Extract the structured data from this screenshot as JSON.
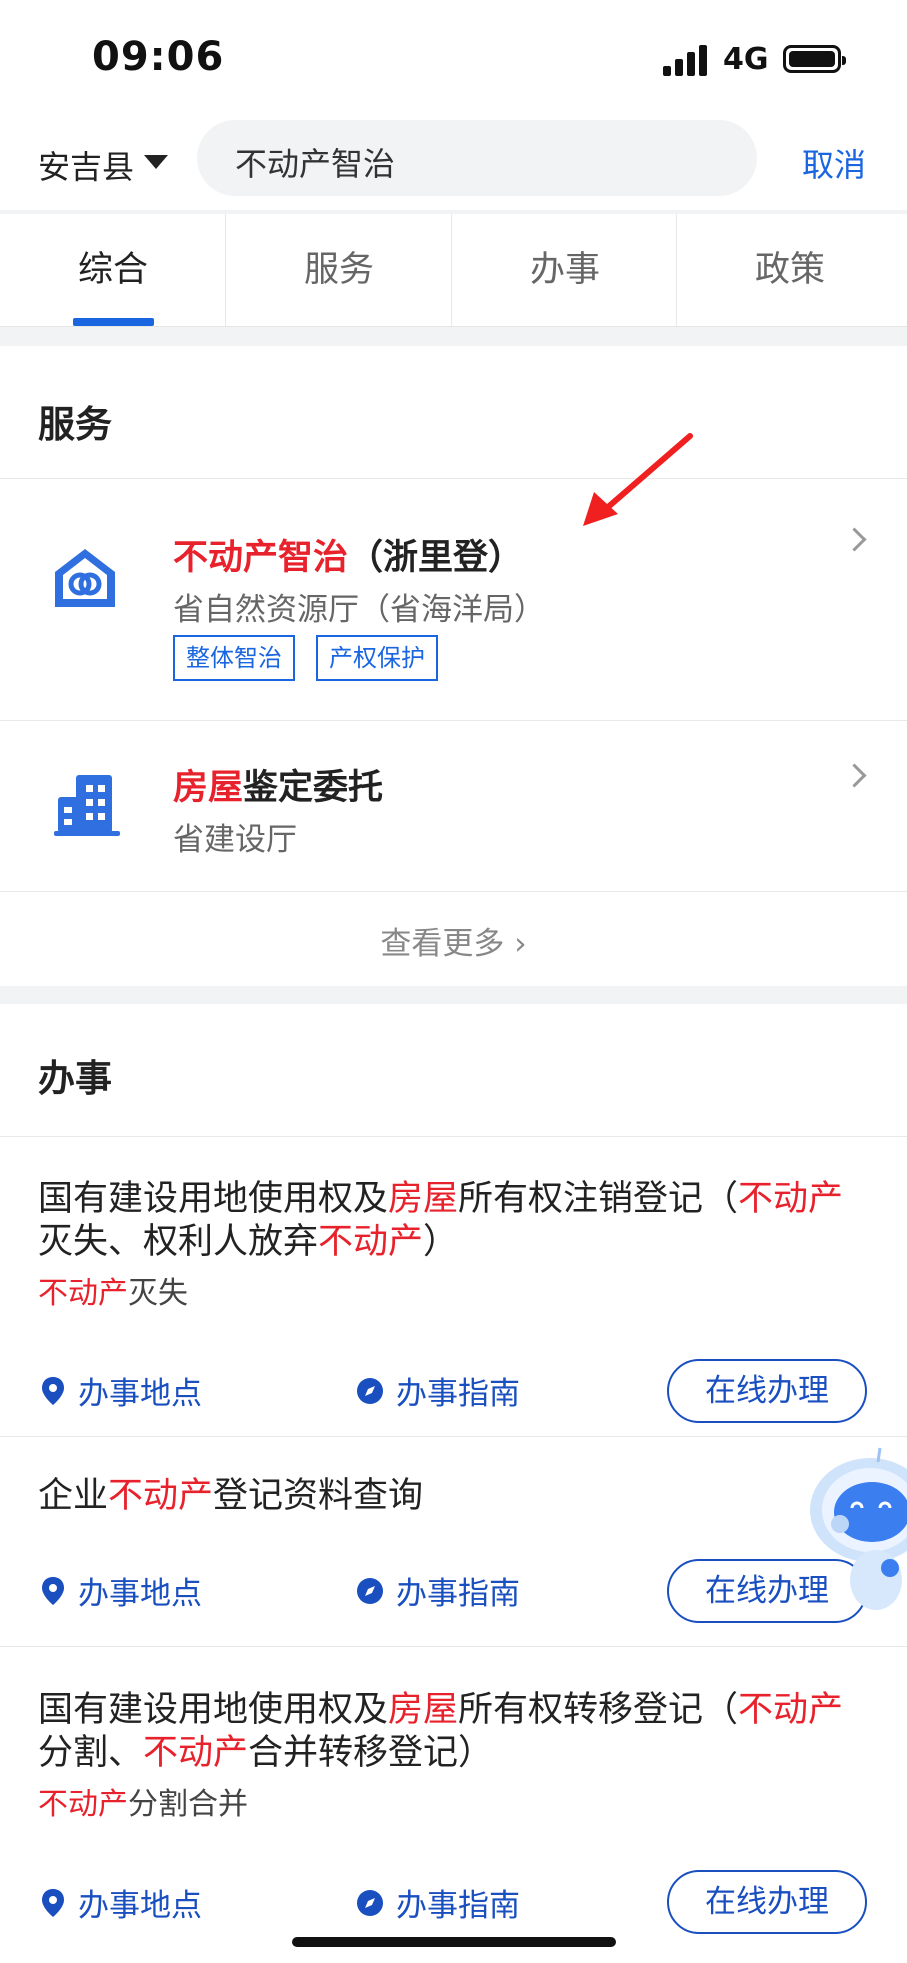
{
  "status_bar": {
    "time": "09:06",
    "network": "4G"
  },
  "header": {
    "location": "安吉县",
    "search_value": "不动产智治",
    "cancel_label": "取消"
  },
  "tabs": [
    {
      "label": "综合"
    },
    {
      "label": "服务"
    },
    {
      "label": "办事"
    },
    {
      "label": "政策"
    }
  ],
  "services": {
    "title": "服务",
    "items": [
      {
        "title_highlight": "不动产智治",
        "title_rest": "（浙里登）",
        "subtitle": "省自然资源厅（省海洋局）",
        "tags": [
          "整体智治",
          "产权保护"
        ],
        "icon": "house-link-icon"
      },
      {
        "title_highlight": "房屋",
        "title_rest": "鉴定委托",
        "subtitle": "省建设厅",
        "icon": "building-icon"
      }
    ],
    "more_label": "查看更多"
  },
  "affairs": {
    "title": "办事",
    "action_location": "办事地点",
    "action_guide": "办事指南",
    "action_online": "在线办理",
    "items": [
      {
        "title": [
          {
            "text": "国有建设用地使用权及",
            "hl": false
          },
          {
            "text": "房屋",
            "hl": true
          },
          {
            "text": "所有权注销登记（",
            "hl": false
          },
          {
            "text": "不动产",
            "hl": true
          },
          {
            "text": "灭失、权利人放弃",
            "hl": false
          },
          {
            "text": "不动产",
            "hl": true
          },
          {
            "text": "）",
            "hl": false
          }
        ],
        "subtitle": [
          {
            "text": "不动产",
            "hl": true
          },
          {
            "text": "灭失",
            "hl": false
          }
        ]
      },
      {
        "title": [
          {
            "text": "企业",
            "hl": false
          },
          {
            "text": "不动产",
            "hl": true
          },
          {
            "text": "登记资料查询",
            "hl": false
          }
        ],
        "subtitle": []
      },
      {
        "title": [
          {
            "text": "国有建设用地使用权及",
            "hl": false
          },
          {
            "text": "房屋",
            "hl": true
          },
          {
            "text": "所有权转移登记（",
            "hl": false
          },
          {
            "text": "不动产",
            "hl": true
          },
          {
            "text": "分割、",
            "hl": false
          },
          {
            "text": "不动产",
            "hl": true
          },
          {
            "text": "合并转移登记）",
            "hl": false
          }
        ],
        "subtitle": [
          {
            "text": "不动产",
            "hl": true
          },
          {
            "text": "分割合并",
            "hl": false
          }
        ]
      }
    ]
  },
  "colors": {
    "accent": "#1a66e0",
    "highlight": "#e8222c",
    "annotation_arrow": "#f02020"
  }
}
